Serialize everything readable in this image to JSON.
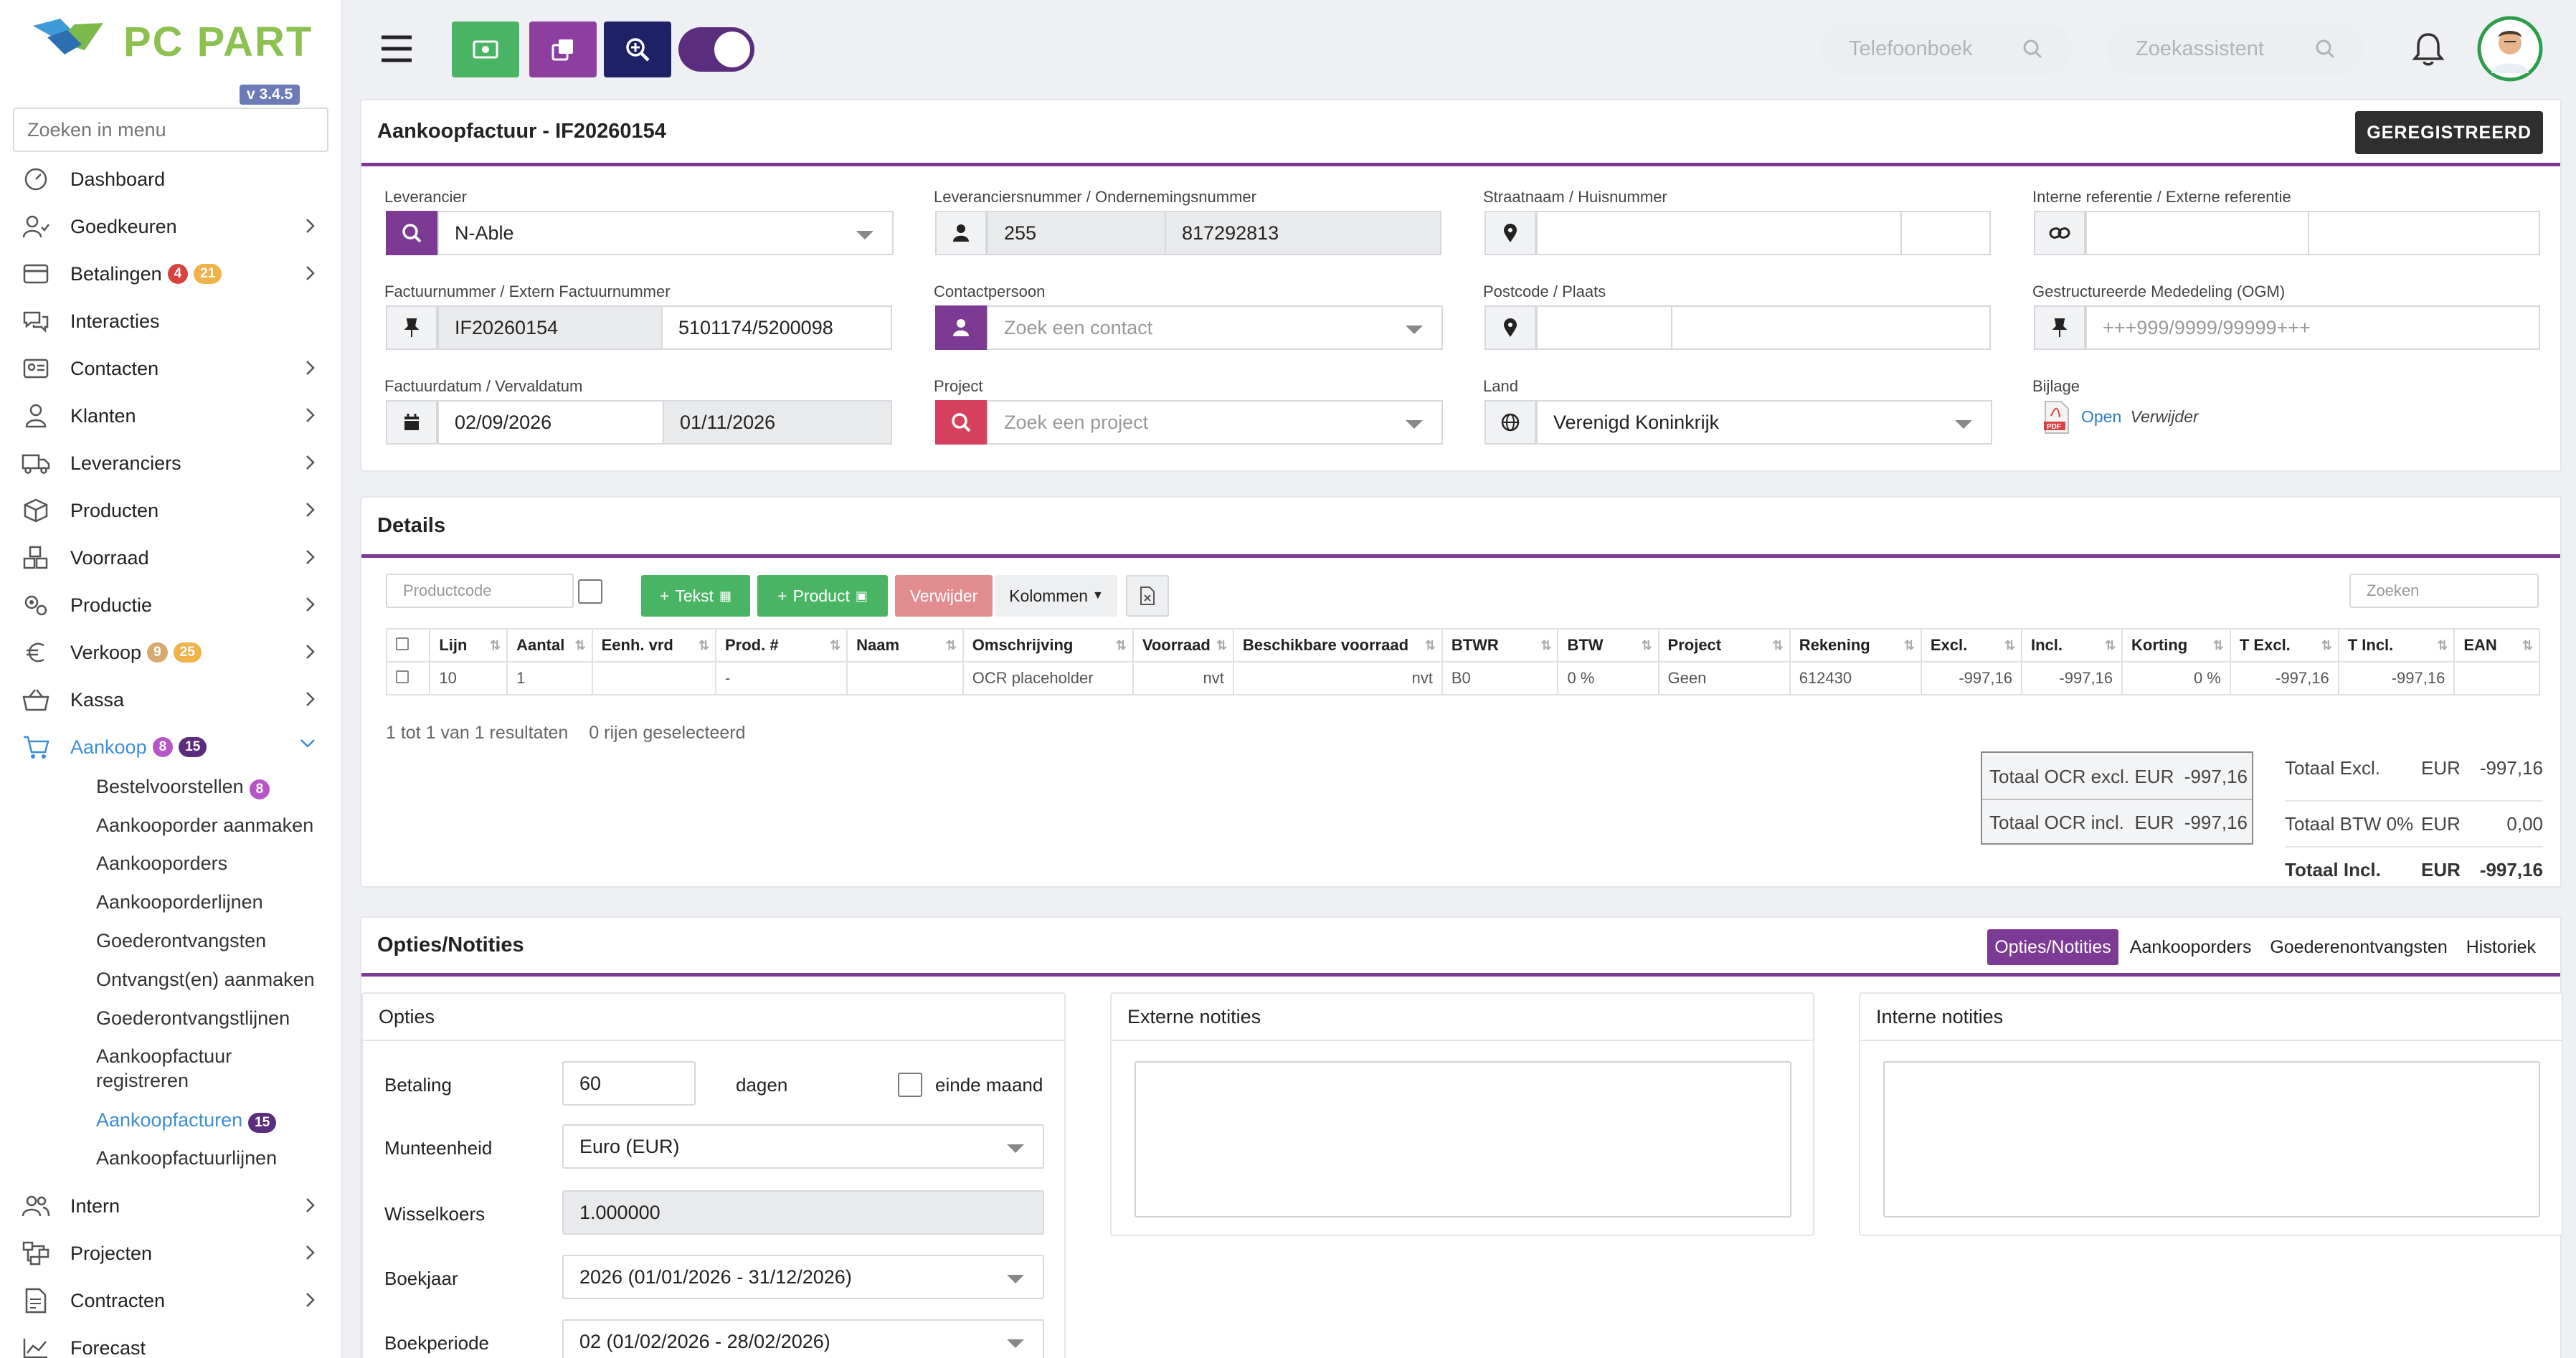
{
  "app": {
    "version": "v 3.4.5",
    "logo_text": "PC PARTNER"
  },
  "sidebar": {
    "search_placeholder": "Zoeken in menu",
    "items": [
      {
        "label": "Dashboard"
      },
      {
        "label": "Goedkeuren"
      },
      {
        "label": "Betalingen",
        "badges": [
          "4",
          "21"
        ]
      },
      {
        "label": "Interacties"
      },
      {
        "label": "Contacten"
      },
      {
        "label": "Klanten"
      },
      {
        "label": "Leveranciers"
      },
      {
        "label": "Producten"
      },
      {
        "label": "Voorraad"
      },
      {
        "label": "Productie"
      },
      {
        "label": "Verkoop",
        "badges": [
          "9",
          "25"
        ]
      },
      {
        "label": "Kassa"
      },
      {
        "label": "Aankoop",
        "badges": [
          "8",
          "15"
        ]
      },
      {
        "label": "Intern"
      },
      {
        "label": "Projecten"
      },
      {
        "label": "Contracten"
      },
      {
        "label": "Forecast"
      }
    ],
    "subitems": [
      {
        "label": "Bestelvoorstellen",
        "badge": "8"
      },
      {
        "label": "Aankooporder aanmaken"
      },
      {
        "label": "Aankooporders"
      },
      {
        "label": "Aankooporderlijnen"
      },
      {
        "label": "Goederontvangsten"
      },
      {
        "label": "Ontvangst(en) aanmaken"
      },
      {
        "label": "Goederontvangstlijnen"
      },
      {
        "label": "Aankoopfactuur registreren"
      },
      {
        "label": "Aankoopfacturen",
        "badge": "15"
      },
      {
        "label": "Aankoopfactuurlijnen"
      }
    ]
  },
  "topbar": {
    "search1_placeholder": "Telefoonboek",
    "search2_placeholder": "Zoekassistent"
  },
  "invoice": {
    "title": "Aankoopfactuur - IF20260154",
    "status": "GEREGISTREERD",
    "leverancier_label": "Leverancier",
    "leverancier": "N-Able",
    "levnr_label": "Leveranciersnummer / Ondernemingsnummer",
    "levnr": "255",
    "ondnr": "817292813",
    "straat_label": "Straatnaam / Huisnummer",
    "intref_label": "Interne referentie / Externe referentie",
    "factnr_label": "Factuurnummer / Extern Factuurnummer",
    "factnr": "IF20260154",
    "extfactnr": "5101174/5200098",
    "contact_label": "Contactpersoon",
    "contact_placeholder": "Zoek een contact",
    "postcode_label": "Postcode / Plaats",
    "ogm_label": "Gestructureerde Mededeling (OGM)",
    "ogm_placeholder": "+++999/9999/99999+++",
    "datum_label": "Factuurdatum / Vervaldatum",
    "factuurdatum": "02/09/2026",
    "vervaldatum": "01/11/2026",
    "project_label": "Project",
    "project_placeholder": "Zoek een project",
    "land_label": "Land",
    "land": "Verenigd Koninkrijk",
    "bijlage_label": "Bijlage",
    "bijlage_open": "Open",
    "bijlage_remove": "Verwijder"
  },
  "details": {
    "title": "Details",
    "productcode_placeholder": "Productcode",
    "btn_tekst": "Tekst",
    "btn_product": "Product",
    "btn_verwijder": "Verwijder",
    "btn_kolommen": "Kolommen",
    "search_placeholder": "Zoeken",
    "columns": [
      "Lijn",
      "Aantal",
      "Eenh. vrd",
      "Prod. #",
      "Naam",
      "Omschrijving",
      "Voorraad",
      "Beschikbare voorraad",
      "BTWR",
      "BTW",
      "Project",
      "Rekening",
      "Excl.",
      "Incl.",
      "Korting",
      "T Excl.",
      "T Incl.",
      "EAN"
    ],
    "rows": [
      [
        "10",
        "1",
        "",
        "-",
        "",
        "OCR placeholder",
        "nvt",
        "nvt",
        "B0",
        "0 %",
        "Geen",
        "612430",
        "-997,16",
        "-997,16",
        "0 %",
        "-997,16",
        "-997,16",
        ""
      ]
    ],
    "footer_info": "1 tot 1 van 1 resultaten",
    "selected_info": "0 rijen geselecteerd",
    "ocr_excl_label": "Totaal OCR excl.",
    "ocr_excl_cur": "EUR",
    "ocr_excl_val": "-997,16",
    "ocr_incl_label": "Totaal OCR incl.",
    "ocr_incl_cur": "EUR",
    "ocr_incl_val": "-997,16",
    "tot_excl_label": "Totaal Excl.",
    "tot_excl_cur": "EUR",
    "tot_excl_val": "-997,16",
    "tot_btw_label": "Totaal BTW 0%",
    "tot_btw_cur": "EUR",
    "tot_btw_val": "0,00",
    "tot_incl_label": "Totaal Incl.",
    "tot_incl_cur": "EUR",
    "tot_incl_val": "-997,16"
  },
  "options": {
    "title": "Opties/Notities",
    "tabs": [
      "Opties/Notities",
      "Aankooporders",
      "Goederenontvangsten",
      "Historiek"
    ],
    "sub_title": "Opties",
    "betaling_label": "Betaling",
    "betaling_value": "60",
    "dagen": "dagen",
    "einde_maand": "einde maand",
    "munt_label": "Munteenheid",
    "munt_value": "Euro (EUR)",
    "wissel_label": "Wisselkoers",
    "wissel_value": "1.000000",
    "boekjaar_label": "Boekjaar",
    "boekjaar_value": "2026 (01/01/2026 - 31/12/2026)",
    "boekperiode_label": "Boekperiode",
    "boekperiode_value": "02 (01/02/2026 - 28/02/2026)",
    "ext_notes": "Externe notities",
    "int_notes": "Interne notities"
  }
}
